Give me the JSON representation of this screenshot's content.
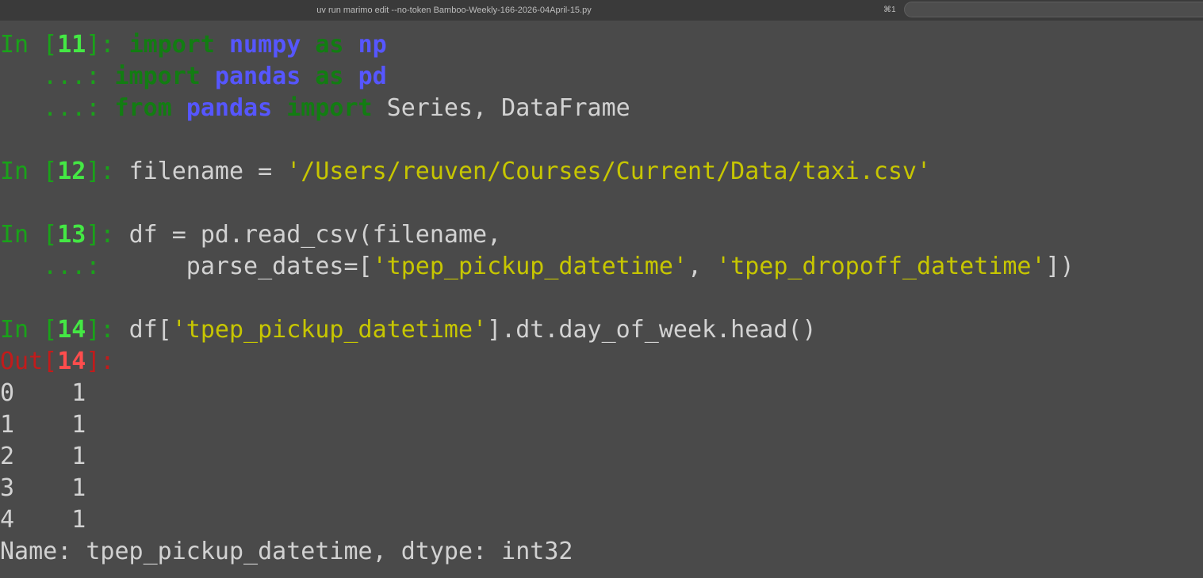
{
  "window": {
    "title": "uv run marimo edit --no-token Bamboo-Weekly-166-2026-04April-15.py",
    "shortcut": "⌘1"
  },
  "colors": {
    "background": "#4a4a4a",
    "prompt_in": "#19a319",
    "prompt_num": "#44e844",
    "prompt_out": "#c21b1b",
    "keyword": "#127d12",
    "module": "#5656ff",
    "string": "#c7c600",
    "text": "#d2d2d2"
  },
  "terminal": {
    "cells": [
      {
        "in_number": "11",
        "lines": [
          "import numpy as np",
          "import pandas as pd",
          "from pandas import Series, DataFrame"
        ]
      },
      {
        "in_number": "12",
        "lines": [
          "filename = '/Users/reuven/Courses/Current/Data/taxi.csv'"
        ]
      },
      {
        "in_number": "13",
        "lines": [
          "df = pd.read_csv(filename,",
          "       parse_dates=['tpep_pickup_datetime', 'tpep_dropoff_datetime'])"
        ]
      },
      {
        "in_number": "14",
        "lines": [
          "df['tpep_pickup_datetime'].dt.day_of_week.head()"
        ],
        "out_number": "14",
        "output": [
          "0    1",
          "1    1",
          "2    1",
          "3    1",
          "4    1",
          "Name: tpep_pickup_datetime, dtype: int32"
        ]
      }
    ]
  }
}
